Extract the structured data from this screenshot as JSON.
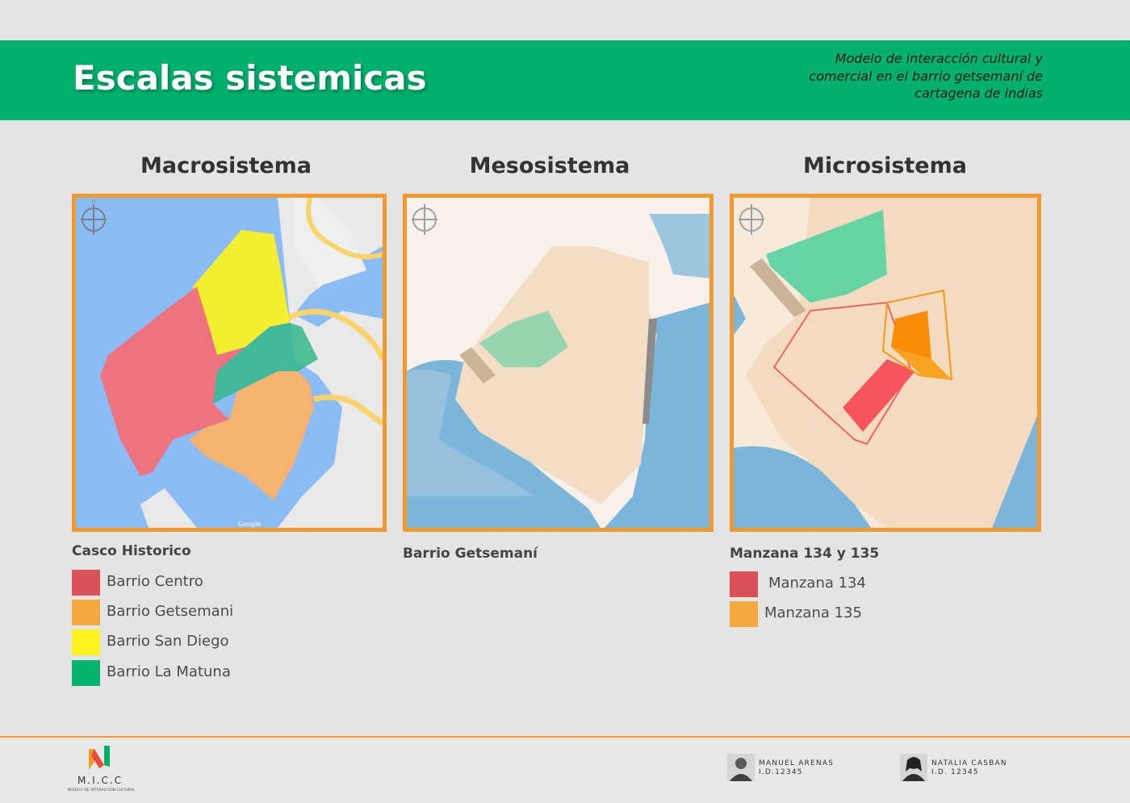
{
  "header": {
    "title": "Escalas sistemicas",
    "subtitle": "Modelo de interacción cultural y comercial en el barrio getsemaní de cartagena de indias"
  },
  "columns": [
    {
      "title": "Macrosistema",
      "caption": "Casco Historico",
      "legend": [
        {
          "label": "Barrio Centro",
          "color": "#dc5158"
        },
        {
          "label": "Barrio Getsemani",
          "color": "#f4a93f"
        },
        {
          "label": "Barrio San Diego",
          "color": "#fdf21e"
        },
        {
          "label": "Barrio La Matuna",
          "color": "#03b36c"
        }
      ]
    },
    {
      "title": "Mesosistema",
      "caption": "Barrio Getsemaní",
      "legend": []
    },
    {
      "title": "Microsistema",
      "caption": "Manzana 134 y 135",
      "legend": [
        {
          "label": "Manzana 134",
          "color": "#dc5158"
        },
        {
          "label": "Manzana 135",
          "color": "#f4a93f"
        }
      ]
    }
  ],
  "maps": {
    "compass_letter": "N",
    "watermark": "Google"
  },
  "footer": {
    "logo_name": "M.I.C.C",
    "logo_tagline": "MODELO DE INTERACCIÓN CULTURAL",
    "authors": [
      {
        "name": "MANUEL ARENAS",
        "id": "I.D.12345"
      },
      {
        "name": "NATALIA CASBAN",
        "id": "I.D. 12345"
      }
    ]
  },
  "colors": {
    "banner": "#02b06c",
    "frame": "#f29a2e",
    "water": "#8bbcf5",
    "land": "#f4ede4"
  }
}
